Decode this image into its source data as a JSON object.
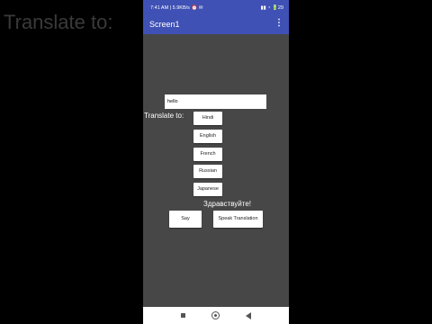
{
  "background_title": "Translate to:",
  "status_bar": {
    "time": "7:41 AM | 5.9KB/s ⏰ ✉",
    "right": "▮▮ ◔ 🔋29"
  },
  "app_bar": {
    "title": "Screen1",
    "menu_icon": "⋮"
  },
  "input": {
    "value": "hello"
  },
  "translate_label": "Translate to:",
  "languages": [
    "Hindi",
    "English",
    "French",
    "Russian",
    "Japanese"
  ],
  "output_text": "Здравствуйте!",
  "buttons": {
    "say": "Say",
    "speak_translation": "Speak Translation"
  },
  "colors": {
    "app_bar": "#3f51b5",
    "screen_background": "#474747"
  }
}
